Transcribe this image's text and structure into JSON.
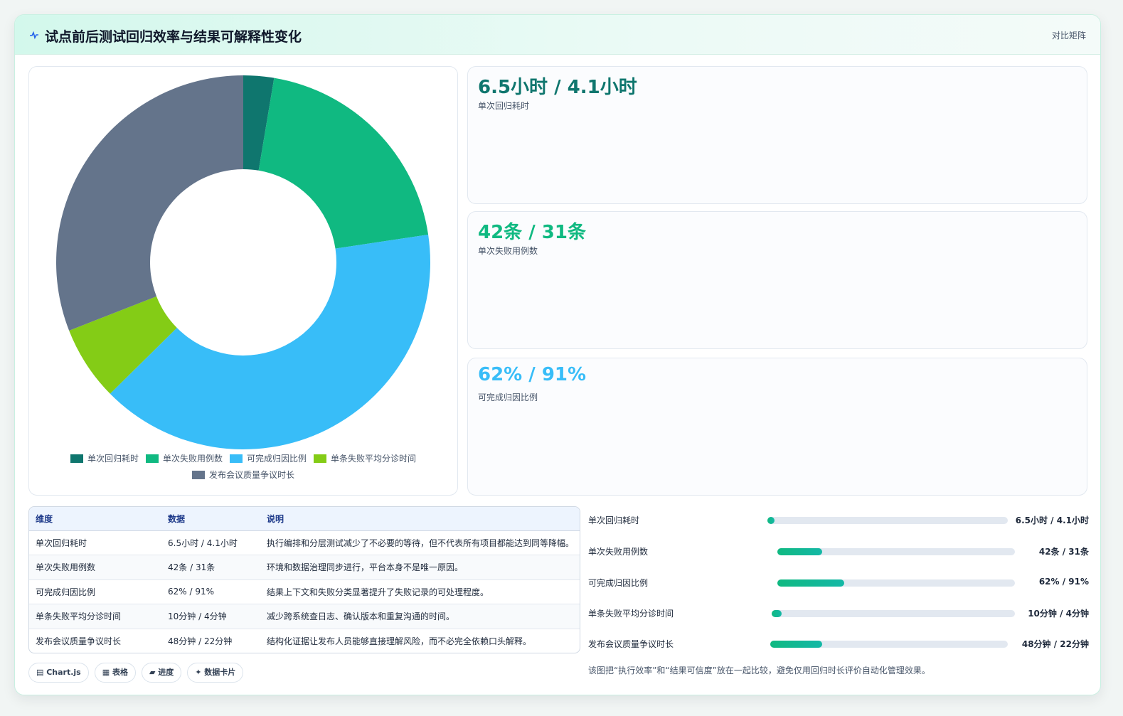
{
  "header": {
    "title": "试点前后测试回归效率与结果可解释性变化",
    "tag": "对比矩阵"
  },
  "colors": {
    "accent": "#10b981",
    "slices": [
      "#0f766e",
      "#10b981",
      "#38bdf8",
      "#84cc16",
      "#64748b"
    ]
  },
  "chart_data": {
    "type": "pie",
    "subtype": "doughnut",
    "categories": [
      "单次回归耗时",
      "单次失败用例数",
      "可完成归因比例",
      "单条失败平均分诊时间",
      "发布会议质量争议时长"
    ],
    "values": [
      4.1,
      31,
      62,
      10,
      48
    ],
    "legend_position": "bottom"
  },
  "stats": [
    {
      "value": "6.5小时 / 4.1小时",
      "label": "单次回归耗时",
      "color": "#0f766e"
    },
    {
      "value": "42条 / 31条",
      "label": "单次失败用例数",
      "color": "#10b981"
    },
    {
      "value": "62% / 91%",
      "label": "可完成归因比例",
      "color": "#38bdf8"
    }
  ],
  "table": {
    "headers": [
      "维度",
      "数据",
      "说明"
    ],
    "rows": [
      [
        "单次回归耗时",
        "6.5小时 / 4.1小时",
        "执行编排和分层测试减少了不必要的等待，但不代表所有项目都能达到同等降幅。"
      ],
      [
        "单次失败用例数",
        "42条 / 31条",
        "环境和数据治理同步进行，平台本身不是唯一原因。"
      ],
      [
        "可完成归因比例",
        "62% / 91%",
        "结果上下文和失败分类显著提升了失败记录的可处理程度。"
      ],
      [
        "单条失败平均分诊时间",
        "10分钟 / 4分钟",
        "减少跨系统查日志、确认版本和重复沟通的时间。"
      ],
      [
        "发布会议质量争议时长",
        "48分钟 / 22分钟",
        "结构化证据让发布人员能够直接理解风险，而不必完全依赖口头解释。"
      ]
    ]
  },
  "chips": [
    "▤ Chart.js",
    "▦ 表格",
    "▰ 进度",
    "✦ 数据卡片"
  ],
  "bars": [
    {
      "label": "单次回归耗时",
      "value": "6.5小时 / 4.1小时",
      "fill": 0.03
    },
    {
      "label": "单次失败用例数",
      "value": "42条 / 31条",
      "fill": 0.19
    },
    {
      "label": "可完成归因比例",
      "value": "62% / 91%",
      "fill": 0.28
    },
    {
      "label": "单条失败平均分诊时间",
      "value": "10分钟 / 4分钟",
      "fill": 0.04
    },
    {
      "label": "发布会议质量争议时长",
      "value": "48分钟 / 22分钟",
      "fill": 0.22
    }
  ],
  "caption": "该图把“执行效率”和“结果可信度”放在一起比较，避免仅用回归时长评价自动化管理效果。"
}
